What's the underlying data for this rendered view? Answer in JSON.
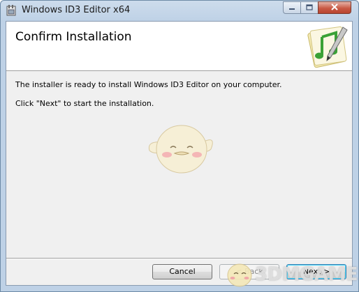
{
  "window": {
    "title": "Windows ID3 Editor x64"
  },
  "banner": {
    "title": "Confirm Installation",
    "icon": "music-note-document-icon"
  },
  "body": {
    "message_line1": "The installer is ready to install Windows ID3 Editor on your computer.",
    "message_line2": "Click \"Next\" to start the installation."
  },
  "buttons": {
    "cancel": "Cancel",
    "back": "< Back",
    "next": "Next >"
  },
  "watermark": {
    "text": "3DMGAME"
  }
}
